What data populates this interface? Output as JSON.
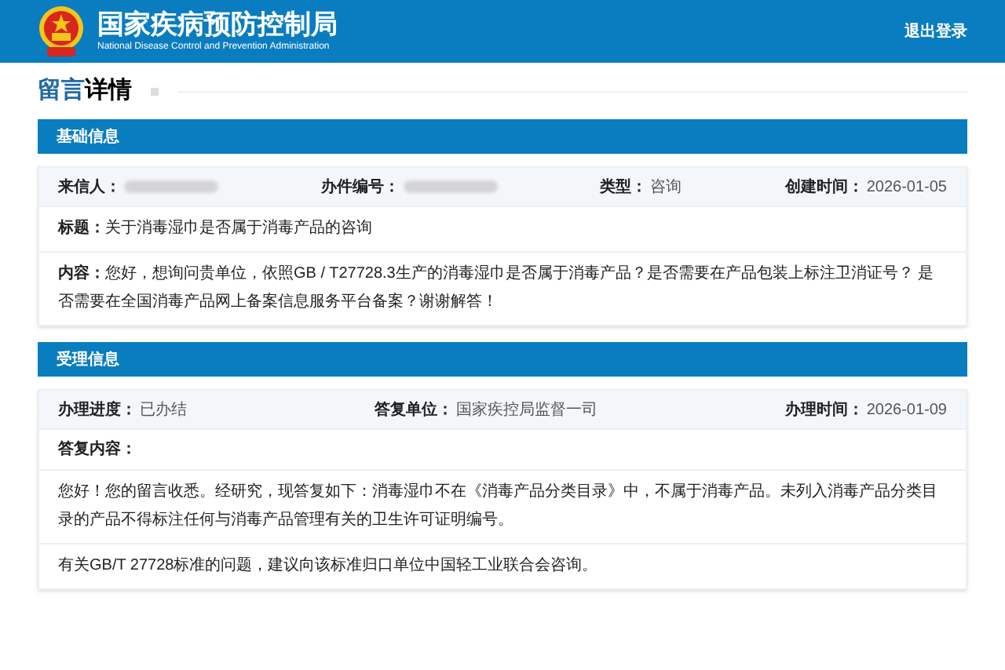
{
  "header": {
    "title": "国家疾病预防控制局",
    "subtitle": "National Disease Control and Prevention Administration",
    "logout": "退出登录"
  },
  "page_title": {
    "accent": "留言",
    "rest": "详情"
  },
  "sections": [
    {
      "title": "基础信息",
      "fields": [
        {
          "label": "来信人：",
          "redacted": true
        },
        {
          "label": "办件编号：",
          "redacted": true
        },
        {
          "label": "类型：",
          "value": "咨询",
          "redacted": false
        },
        {
          "label": "创建时间：",
          "value": "2026-01-05",
          "redacted": false
        }
      ],
      "rows": [
        {
          "kind": "labeled",
          "label": "标题：",
          "text": "关于消毒湿巾是否属于消毒产品的咨询"
        },
        {
          "kind": "labeled",
          "label": "内容：",
          "text": "您好，想询问贵单位，依照GB / T27728.3生产的消毒湿巾是否属于消毒产品？是否需要在产品包装上标注卫消证号？ 是否需要在全国消毒产品网上备案信息服务平台备案？谢谢解答！"
        }
      ]
    },
    {
      "title": "受理信息",
      "fields": [
        {
          "label": "办理进度：",
          "value": "已办结",
          "redacted": false
        },
        {
          "label": "答复单位：",
          "value": "国家疾控局监督一司",
          "redacted": false
        },
        {
          "label": "办理时间：",
          "value": "2026-01-09",
          "redacted": false
        }
      ],
      "rows": [
        {
          "kind": "heading",
          "label": "答复内容："
        },
        {
          "kind": "paragraph",
          "text": "您好！您的留言收悉。经研究，现答复如下：消毒湿巾不在《消毒产品分类目录》中，不属于消毒产品。未列入消毒产品分类目录的产品不得标注任何与消毒产品管理有关的卫生许可证明编号。"
        },
        {
          "kind": "paragraph",
          "text": "有关GB/T 27728标准的问题，建议向该标准归口单位中国轻工业联合会咨询。"
        }
      ]
    }
  ]
}
